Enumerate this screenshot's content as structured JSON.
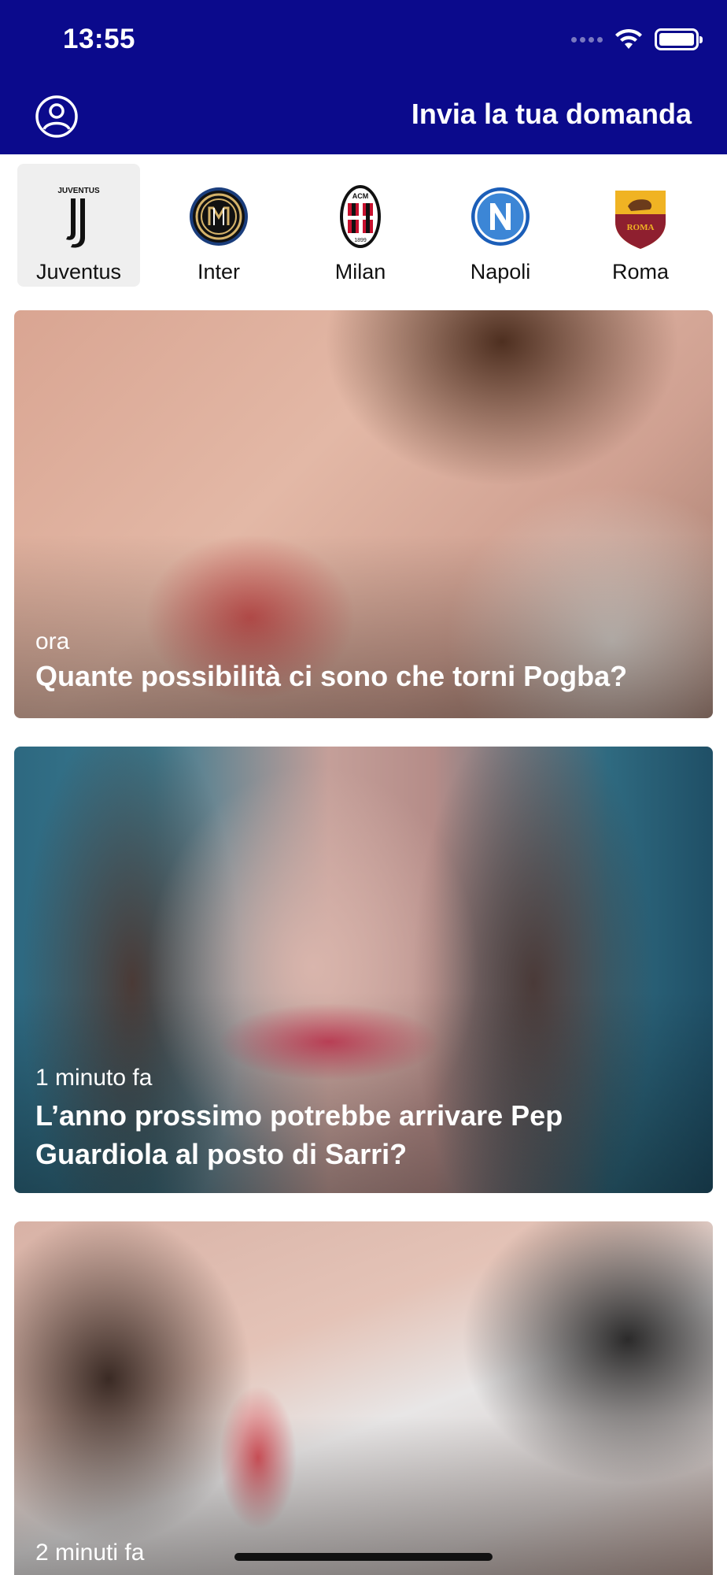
{
  "status_bar": {
    "time": "13:55"
  },
  "header": {
    "ask_label": "Invia la tua domanda",
    "background": "#0b0a8c"
  },
  "teams": [
    {
      "label": "Juventus",
      "selected": true
    },
    {
      "label": "Inter",
      "selected": false
    },
    {
      "label": "Milan",
      "selected": false
    },
    {
      "label": "Napoli",
      "selected": false
    },
    {
      "label": "Roma",
      "selected": false
    }
  ],
  "logo_text": {
    "juventus": "JUVENTUS",
    "milan_top": "ACM",
    "milan_year": "1899",
    "roma": "ROMA"
  },
  "cards": [
    {
      "time": "ora",
      "title": "Quante possibilità ci sono che torni Pogba?"
    },
    {
      "time": "1 minuto fa",
      "title": "L’anno prossimo potrebbe arrivare Pep Guardiola al posto di Sarri?"
    },
    {
      "time": "2 minuti fa",
      "title": ""
    }
  ]
}
